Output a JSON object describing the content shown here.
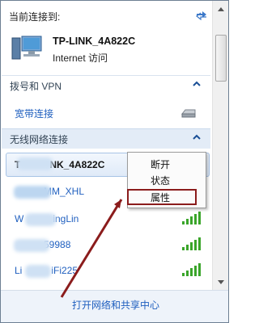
{
  "header": {
    "title": "当前连接到:",
    "refresh_icon": "refresh-arrows-icon"
  },
  "current_connection": {
    "name": "TP-LINK_4A822C",
    "status": "Internet 访问",
    "icon": "network-monitor-icon"
  },
  "sections": {
    "dialup": {
      "label": "拨号和 VPN",
      "caret": "chevron-up-icon"
    },
    "broadband": {
      "label": "宽带连接",
      "icon": "modem-icon"
    },
    "wireless": {
      "label": "无线网络连接",
      "caret": "chevron-up-icon"
    }
  },
  "wifi_networks": [
    {
      "name": "T   NK_4A822C",
      "selected": true
    },
    {
      "name": "   MM_XHL",
      "signal": 5
    },
    {
      "name": "W   ingLin",
      "signal": 5
    },
    {
      "name": "   59988",
      "signal": 5
    },
    {
      "name": "Li   iFi225",
      "signal": 5
    }
  ],
  "context_menu": {
    "items": [
      "断开",
      "状态",
      "属性"
    ],
    "highlighted": "属性"
  },
  "footer": {
    "link": "打开网络和共享中心"
  },
  "colors": {
    "link": "#1f5fbf",
    "highlight_box": "#8b1c1c",
    "signal_green": "#3aa52a"
  }
}
